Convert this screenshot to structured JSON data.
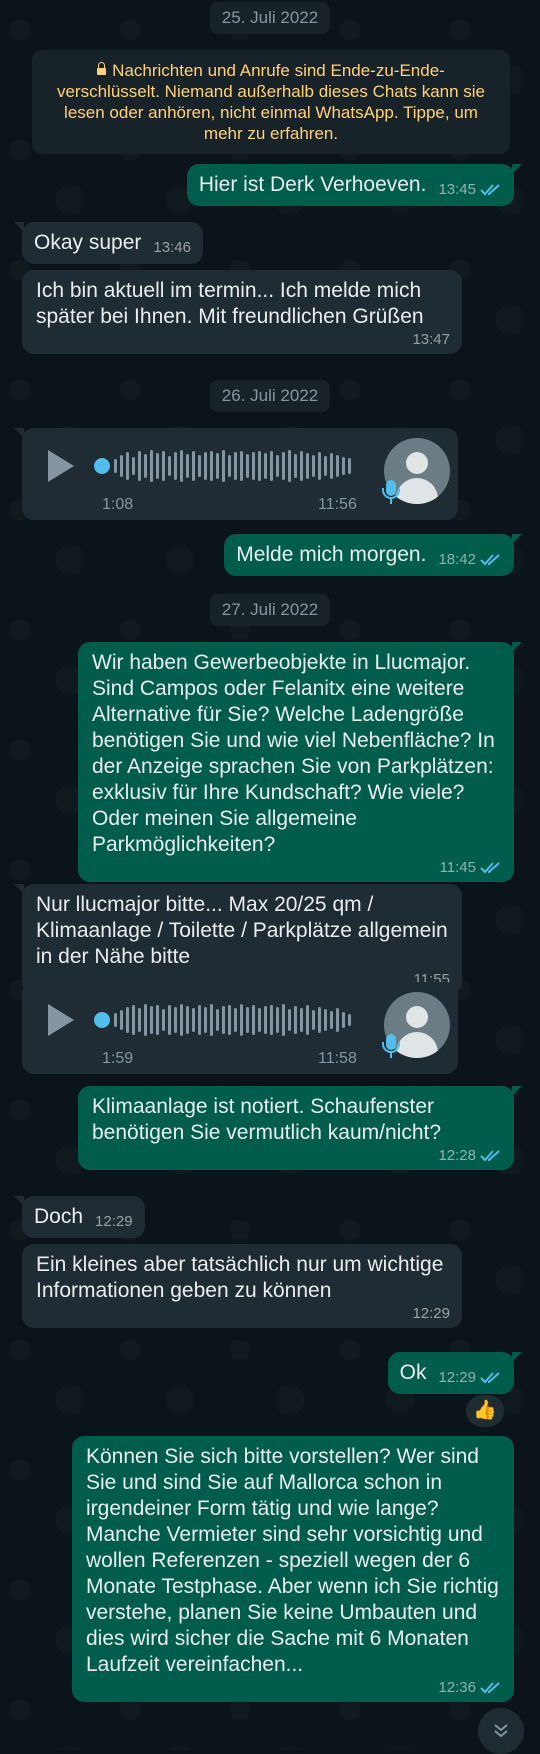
{
  "encryption_notice": "Nachrichten und Anrufe sind Ende-zu-Ende-verschlüsselt. Niemand außerhalb dieses Chats kann sie lesen oder anhören, nicht einmal WhatsApp. Tippe, um mehr zu erfahren.",
  "dates": [
    "25. Juli 2022",
    "26. Juli 2022",
    "27. Juli 2022"
  ],
  "messages": [
    {
      "text": "Hier ist Derk Verhoeven.",
      "time": "13:45",
      "dir": "out"
    },
    {
      "text": "Okay super",
      "time": "13:46",
      "dir": "in"
    },
    {
      "text": "Ich bin aktuell im termin... Ich melde mich später bei Ihnen. Mit freundlichen Grüßen",
      "time": "13:47",
      "dir": "in"
    },
    {
      "text": "Melde mich morgen.",
      "time": "18:42",
      "dir": "out"
    },
    {
      "text": "Wir haben Gewerbeobjekte in Llucmajor. Sind Campos oder Felanitx eine weitere Alternative für Sie? Welche Ladengröße benötigen Sie und wie viel Nebenfläche? In der Anzeige sprachen Sie von Parkplätzen: exklusiv für Ihre Kundschaft? Wie viele? Oder meinen Sie allgemeine Parkmöglichkeiten?",
      "time": "11:45",
      "dir": "out"
    },
    {
      "text": "Nur llucmajor bitte... Max 20/25 qm / Klimaanlage / Toilette / Parkplätze allgemein in der Nähe bitte",
      "time": "11:55",
      "dir": "in"
    },
    {
      "text": "Klimaanlage ist notiert. Schaufenster benötigen Sie vermutlich kaum/nicht?",
      "time": "12:28",
      "dir": "out"
    },
    {
      "text": "Doch",
      "time": "12:29",
      "dir": "in"
    },
    {
      "text": "Ein kleines aber tatsächlich nur um wichtige Informationen geben zu können",
      "time": "12:29",
      "dir": "in"
    },
    {
      "text": "Ok",
      "time": "12:29",
      "dir": "out"
    },
    {
      "text": "Können Sie sich bitte vorstellen? Wer sind Sie und sind Sie auf Mallorca schon in irgendeiner Form tätig und wie lange? Manche Vermieter sind sehr vorsichtig und wollen Referenzen - speziell wegen der 6 Monate Testphase. Aber wenn ich Sie richtig verstehe, planen Sie keine Umbauten und dies wird sicher die Sache mit 6 Monaten Laufzeit vereinfachen...",
      "time": "12:36",
      "dir": "out"
    }
  ],
  "voice_notes": [
    {
      "duration": "1:08",
      "time": "11:56"
    },
    {
      "duration": "1:59",
      "time": "11:58"
    }
  ],
  "reaction": "👍",
  "icons": {
    "play": "play-icon",
    "mic": "microphone-icon",
    "ticks": "double-check-icon",
    "scroll": "double-chevron-down-icon"
  },
  "colors": {
    "bg": "#0b141a",
    "outgoing": "#005c4b",
    "incoming": "#202c33",
    "tick_blue": "#53bdeb",
    "notice": "#ffd279"
  }
}
